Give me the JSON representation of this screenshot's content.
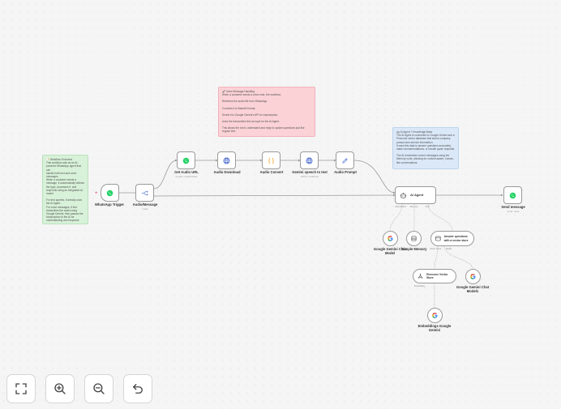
{
  "notes": {
    "overview": {
      "title": "📝 Workflow Overview",
      "lines": [
        "This workflow acts as an AI-",
        "powered WhatsApp agent that can",
        "handle both text and voice",
        "messages.",
        "When a customer sends a",
        "message, it automatically detects",
        "the type, processes it, and",
        "responds using an integrated AI",
        "model.",
        "",
        "For text queries, it directly uses",
        "the AI Agent.",
        "For voice messages, it first",
        "transcribes the audio using",
        "Google Gemini, then passes the",
        "transcription to the AI for",
        "understanding and response."
      ]
    },
    "voice": {
      "title": "🎤 Voice Message Handling",
      "lines": [
        "When a customer sends a voice note, the workflow:",
        "",
        "Retrieves the audio file from WhatsApp.",
        "",
        "Converts it to Base64 format.",
        "",
        "Sends it to Google Gemini's API for transcription.",
        "",
        "Uses the transcribed text as input for the AI Agent.",
        "",
        "This allows the bot to understand and reply to spoken questions just like",
        "regular text."
      ]
    },
    "agent": {
      "title": "🤖 AI Agent + Knowledge Base",
      "lines": [
        "The AI Agent is connected to Google Gemini and a",
        "Pinecone vector database that stores company",
        "product and service information.",
        "It uses this data to answer questions accurately,",
        "make recommendations, or handle quote requests.",
        "",
        "The AI remembers recent messages using the",
        "Memory node, allowing for context-aware, human-",
        "like conversations."
      ]
    }
  },
  "nodes": {
    "whatsapp_trigger": {
      "label": "WhatsApp Trigger",
      "sub": ""
    },
    "audio_message": {
      "label": "Audio/Message",
      "sub": "mode"
    },
    "get_audio_url": {
      "label": "Get Audio URL",
      "sub": "media: mediaUrlGet"
    },
    "audio_download": {
      "label": "Audio Download",
      "sub": ""
    },
    "audio_convert": {
      "label": "Audio Convert",
      "sub": ""
    },
    "gemini_speech": {
      "label": "Gemini speech to text",
      "sub": "POST: /endPoint"
    },
    "audio_prompt": {
      "label": "Audio Prompt",
      "sub": ""
    },
    "ai_agent": {
      "label": "AI Agent",
      "ports": [
        "Chat Model*",
        "Memory",
        "Tool"
      ]
    },
    "send_message": {
      "label": "Send message",
      "sub": "send: send"
    },
    "gemini_chat_model": {
      "label": "Google Gemini Chat Model",
      "sub": ""
    },
    "simple_memory": {
      "label": "Simple Memory",
      "sub": ""
    },
    "answer_questions": {
      "label": "Answer questions with a vector store",
      "ports": [
        "Vector Store",
        "Model"
      ]
    },
    "pinecone": {
      "label": "Pinecone Vector Store",
      "ports": [
        "Embedding"
      ]
    },
    "gemini_chat_model1": {
      "label": "Google Gemini Chat Model1",
      "sub": ""
    },
    "embeddings": {
      "label": "Embeddings Google Gemini",
      "sub": ""
    }
  },
  "ports": {
    "chat_model": "Chat Model",
    "memory": "Memory",
    "tool": "Tool",
    "vector_store": "Vector Store",
    "model": "Model",
    "embedding": "Embedding"
  },
  "toolbar": {
    "fit_view": "fit-view",
    "zoom_in": "zoom-in",
    "zoom_out": "zoom-out",
    "undo": "undo"
  },
  "colors": {
    "whatsapp": "#25d366",
    "edge": "#9a9a9a",
    "globe": "#3f63cc",
    "code": "#f3a523",
    "pen": "#5f7fd6",
    "note_green": "#d8f1d9",
    "note_pink": "#fbd2d6",
    "note_blue": "#dbe8f8"
  }
}
